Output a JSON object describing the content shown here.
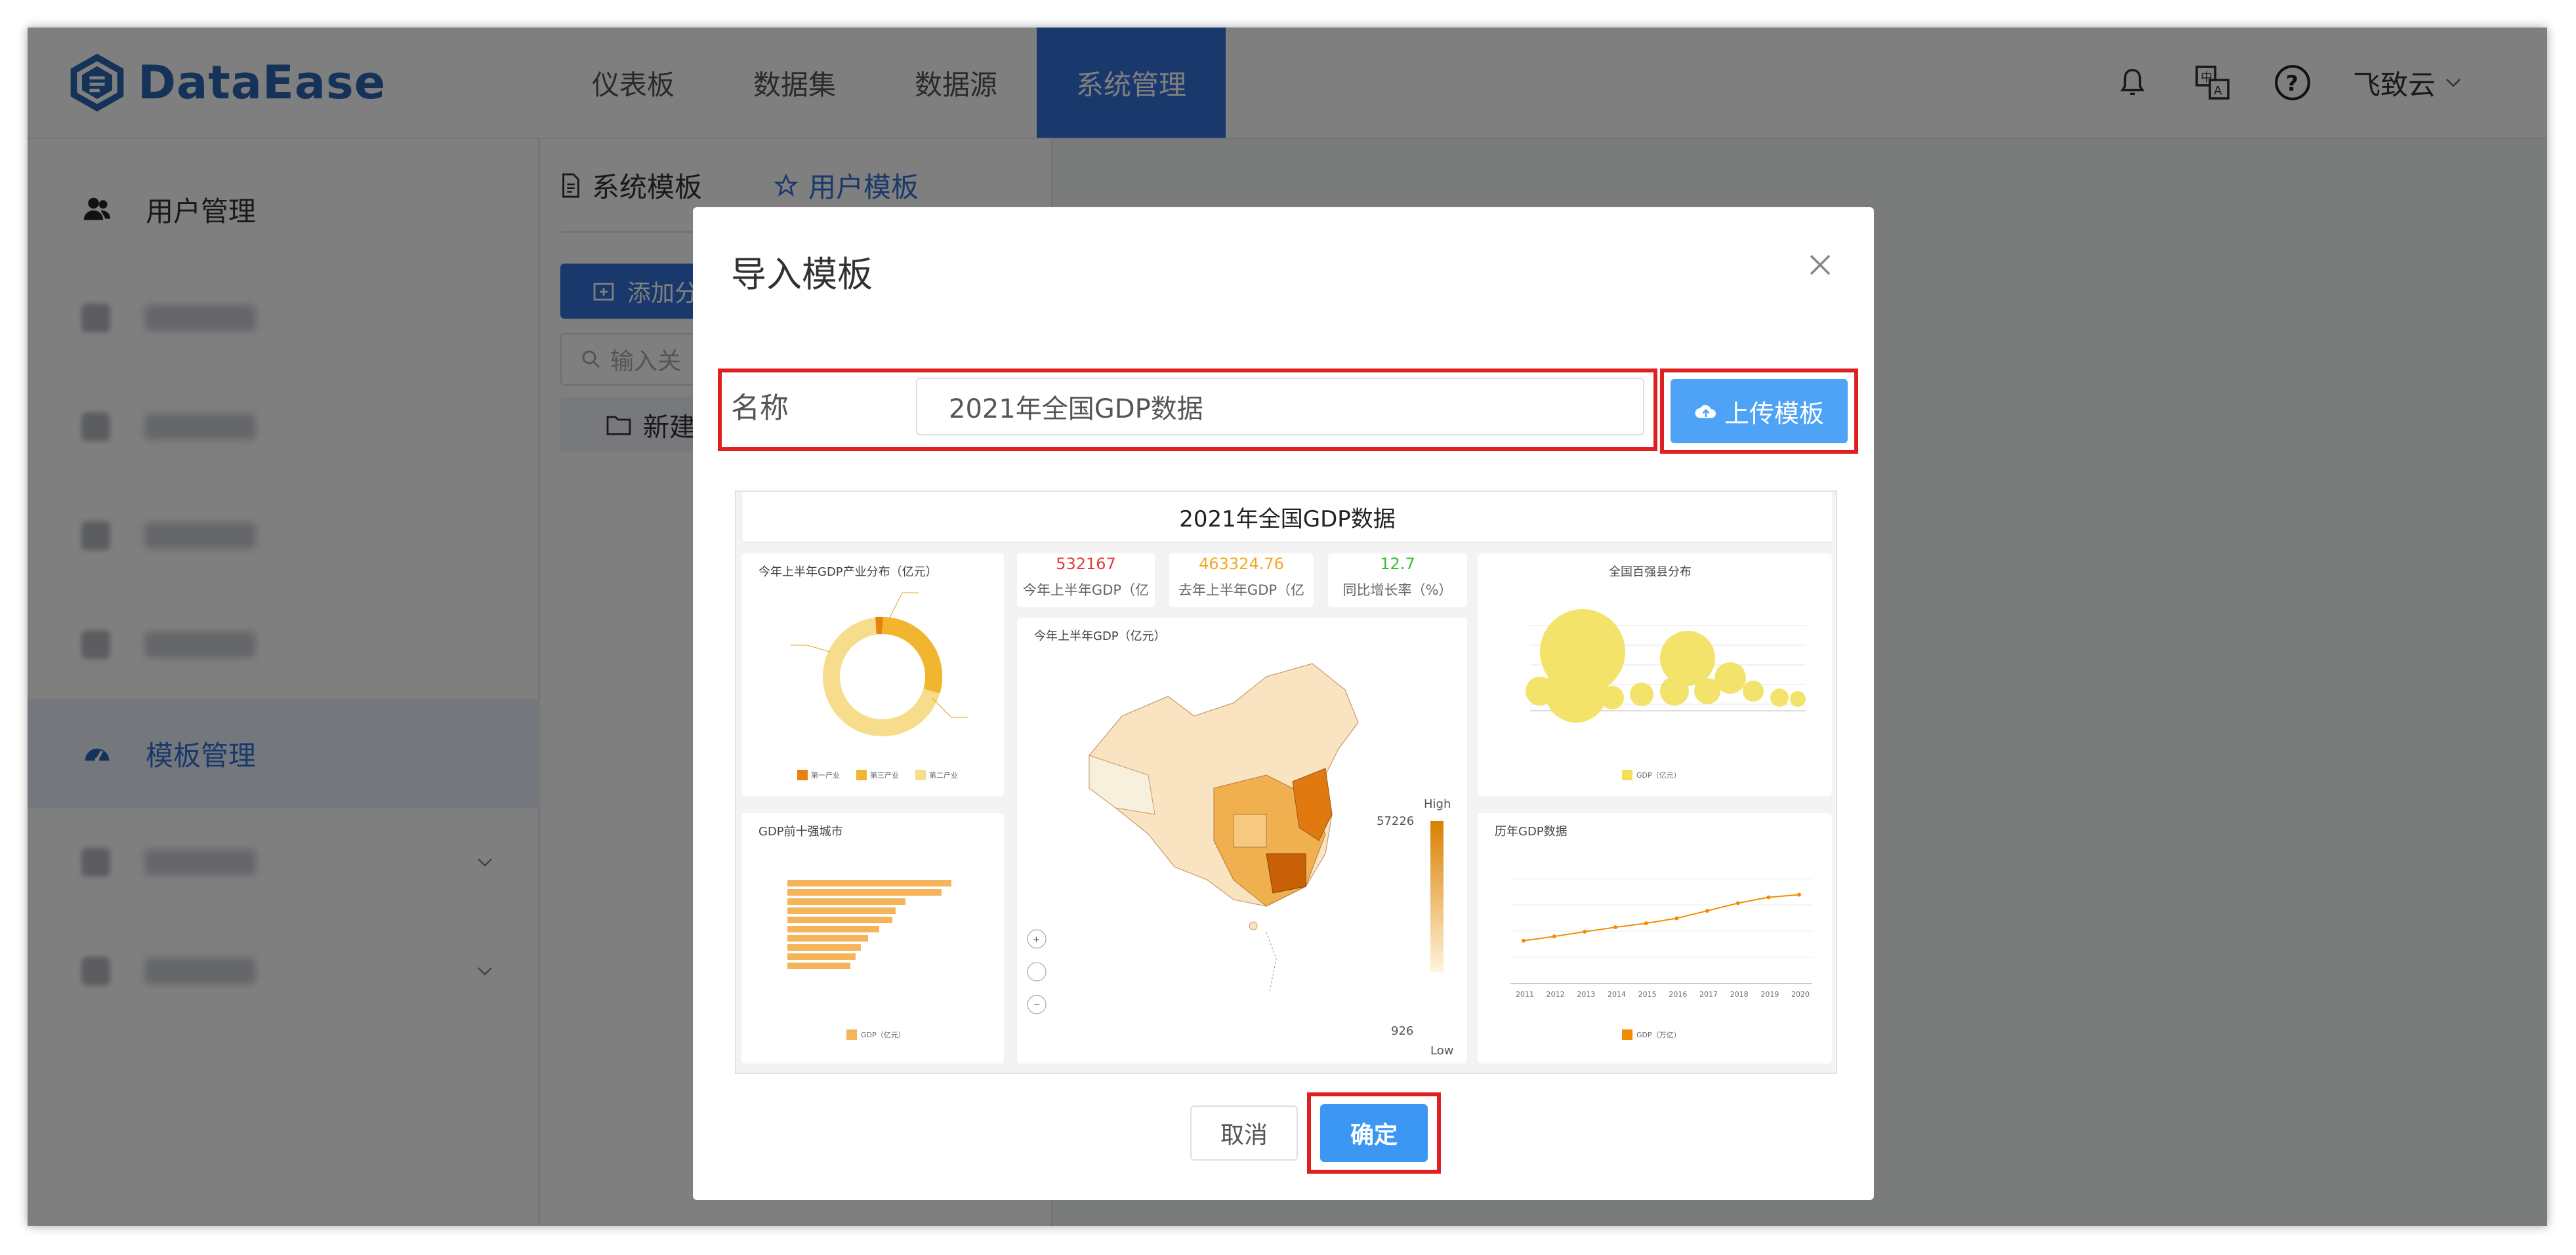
{
  "header": {
    "logo_text": "DataEase",
    "nav": [
      "仪表板",
      "数据集",
      "数据源",
      "系统管理"
    ],
    "active_nav": "系统管理",
    "user_name": "飞致云"
  },
  "sidebar": {
    "items": [
      {
        "label": "用户管理",
        "icon": "user-icon",
        "blurred": false
      },
      {
        "label": "",
        "blurred": true
      },
      {
        "label": "",
        "blurred": true
      },
      {
        "label": "",
        "blurred": true
      },
      {
        "label": "",
        "blurred": true
      },
      {
        "label": "模板管理",
        "icon": "dashboard-icon",
        "blurred": false,
        "active": true
      },
      {
        "label": "",
        "blurred": true,
        "expandable": true
      },
      {
        "label": "",
        "blurred": true,
        "expandable": true
      }
    ]
  },
  "template_panel": {
    "tabs": [
      "系统模板",
      "用户模板"
    ],
    "add_button": "添加分",
    "search_placeholder": "输入关",
    "folder": "新建"
  },
  "dialog": {
    "title": "导入模板",
    "name_label": "名称",
    "name_value": "2021年全国GDP数据",
    "upload_button": "上传模板",
    "cancel_button": "取消",
    "ok_button": "确定"
  },
  "preview": {
    "title": "2021年全国GDP数据",
    "donut_title": "今年上半年GDP产业分布（亿元）",
    "donut_legend": [
      "第一产业",
      "第三产业",
      "第二产业"
    ],
    "kpis": [
      {
        "value": "532167",
        "label": "今年上半年GDP（亿",
        "color": "#e8383d"
      },
      {
        "value": "463324.76",
        "label": "去年上半年GDP（亿",
        "color": "#f5a623"
      },
      {
        "value": "12.7",
        "label": "同比增长率（%）",
        "color": "#2fbf2f"
      }
    ],
    "bubble_title": "全国百强县分布",
    "bubble_legend": "GDP（亿元）",
    "map_title": "今年上半年GDP（亿元）",
    "map_high": "High",
    "map_low": "Low",
    "map_max": "57226",
    "map_min": "926",
    "bar_title": "GDP前十强城市",
    "bar_legend": "GDP（亿元）",
    "line_title": "历年GDP数据",
    "line_legend": "GDP（万亿）",
    "line_years": [
      "2011",
      "2012",
      "2013",
      "2014",
      "2015",
      "2016",
      "2017",
      "2018",
      "2019",
      "2020"
    ],
    "line_values": [
      48.93,
      53.86,
      59.3,
      64.36,
      68.89,
      74.64,
      83.2,
      91.93,
      98.65,
      101.6
    ]
  },
  "colors": {
    "brand": "#3370d6",
    "highlight": "#e02020",
    "upload": "#4fa3f7",
    "confirm": "#3c97f4"
  }
}
